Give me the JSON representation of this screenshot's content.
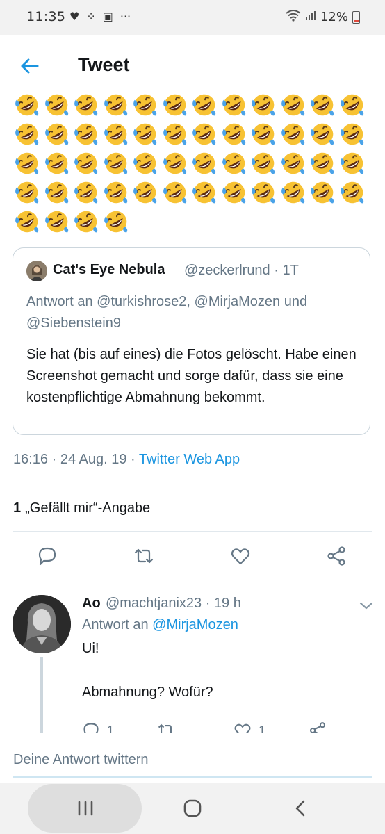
{
  "status_bar": {
    "time": "11:35",
    "left_icons": [
      "heart-icon",
      "dots-icon",
      "gallery-icon",
      "more-icon"
    ],
    "battery": "12%"
  },
  "header": {
    "title": "Tweet"
  },
  "tweet": {
    "emoji": "🤣",
    "emoji_rows": [
      12,
      12,
      12,
      12,
      4
    ],
    "quoted": {
      "name": "Cat's Eye Nebula",
      "handle_time": "@zeckerlrund · 1T",
      "reply_to": "Antwort an @turkishrose2, @MirjaMozen und @Siebenstein9",
      "text": "Sie hat (bis auf eines) die Fotos gelöscht. Habe einen Screenshot gemacht und sorge dafür, dass sie eine kostenpflichtige Abmahnung bekommt."
    },
    "timestamp": "16:16 · 24 Aug. 19 · ",
    "source": "Twitter Web App",
    "likes_count": "1",
    "likes_label": "„Gefällt mir“-Angabe"
  },
  "reply": {
    "name": "Ao",
    "handle_time": "@machtjanix23 · 19 h",
    "reply_prefix": "Antwort an ",
    "reply_to": "@MirjaMozen",
    "line1": "Ui!",
    "line2": "Abmahnung? Wofür?",
    "reply_count": "1",
    "like_count": "1"
  },
  "compose": {
    "placeholder": "Deine Antwort twittern"
  },
  "colors": {
    "accent": "#1b95e0",
    "secondary_text": "#657786",
    "border": "#e1e8ed"
  }
}
